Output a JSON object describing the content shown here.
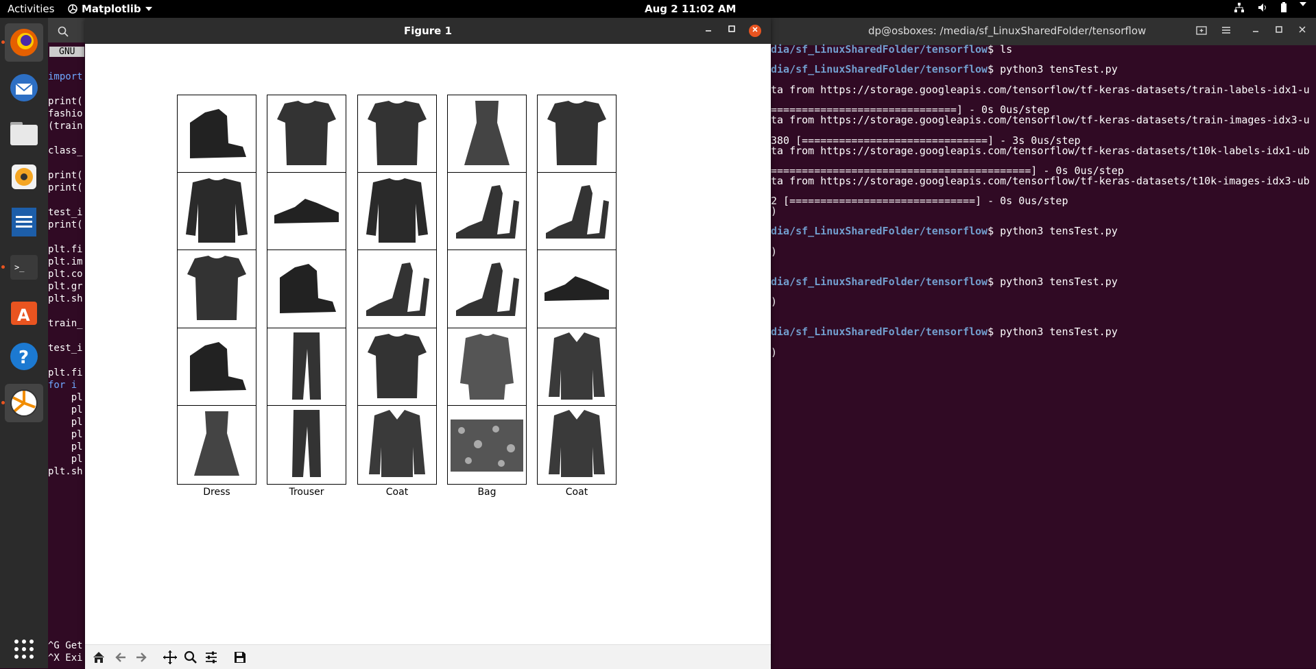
{
  "topbar": {
    "activities": "Activities",
    "app_name": "Matplotlib",
    "clock": "Aug 2  11:02 AM"
  },
  "editor": {
    "gnu_label": "GNU",
    "lines": [
      {
        "text": "import"
      },
      {
        "text": "print("
      },
      {
        "text": "fashio"
      },
      {
        "text": "(train"
      },
      {
        "text": "class_"
      },
      {
        "text": "print("
      },
      {
        "text": "print("
      },
      {
        "text": "test_i"
      },
      {
        "text": "print("
      },
      {
        "text": "plt.fi"
      },
      {
        "text": "plt.im"
      },
      {
        "text": "plt.co"
      },
      {
        "text": "plt.gr"
      },
      {
        "text": "plt.sh"
      },
      {
        "text": "train_"
      },
      {
        "text": "test_i"
      },
      {
        "text": "plt.fi"
      },
      {
        "text": "for i"
      },
      {
        "text": "    pl"
      },
      {
        "text": "    pl"
      },
      {
        "text": "    pl"
      },
      {
        "text": "    pl"
      },
      {
        "text": "    pl"
      },
      {
        "text": "    pl"
      },
      {
        "text": "plt.sh"
      },
      {
        "text": "^G Get"
      },
      {
        "text": "^X Exi"
      }
    ]
  },
  "terminal": {
    "title": "dp@osboxes: /media/sf_LinuxSharedFolder/tensorflow",
    "lines": [
      {
        "path": "dia/sf_LinuxSharedFolder/tensorflow",
        "text": "$ ls"
      },
      {
        "path": "dia/sf_LinuxSharedFolder/tensorflow",
        "text": "$ python3 tensTest.py"
      },
      {
        "path": "",
        "text": "ta from https://storage.googleapis.com/tensorflow/tf-keras-datasets/train-labels-idx1-u"
      },
      {
        "path": "",
        "text": "==============================] - 0s 0us/step"
      },
      {
        "path": "",
        "text": "ta from https://storage.googleapis.com/tensorflow/tf-keras-datasets/train-images-idx3-u"
      },
      {
        "path": "",
        "text": "380 [==============================] - 3s 0us/step"
      },
      {
        "path": "",
        "text": "ta from https://storage.googleapis.com/tensorflow/tf-keras-datasets/t10k-labels-idx1-ub"
      },
      {
        "path": "",
        "text": "==========================================] - 0s 0us/step"
      },
      {
        "path": "",
        "text": "ta from https://storage.googleapis.com/tensorflow/tf-keras-datasets/t10k-images-idx3-ub"
      },
      {
        "path": "",
        "text": "2 [==============================] - 0s 0us/step"
      },
      {
        "path": "",
        "text": ")"
      },
      {
        "path": "dia/sf_LinuxSharedFolder/tensorflow",
        "text": "$ python3 tensTest.py"
      },
      {
        "path": "",
        "text": ")"
      },
      {
        "path": "dia/sf_LinuxSharedFolder/tensorflow",
        "text": "$ python3 tensTest.py"
      },
      {
        "path": "",
        "text": ")"
      },
      {
        "path": "dia/sf_LinuxSharedFolder/tensorflow",
        "text": "$ python3 tensTest.py"
      },
      {
        "path": "",
        "text": ")"
      }
    ]
  },
  "figure": {
    "title": "Figure 1",
    "captions": [
      "Ankle boot",
      "T-shirt/top",
      "T-shirt/top",
      "Dress",
      "T-shirt/top",
      "Pullover",
      "Sneaker",
      "Pullover",
      "Sandal",
      "Sandal",
      "T-shirt/top",
      "Ankle boot",
      "Sandal",
      "Sandal",
      "Sneaker",
      "Ankle boot",
      "Trouser",
      "T-shirt/top",
      "Shirt",
      "Coat",
      "Dress",
      "Trouser",
      "Coat",
      "Bag",
      "Coat"
    ]
  },
  "colors": {
    "accent": "#e95420",
    "terminal_bg": "#300a24",
    "path_blue": "#729fcf"
  }
}
